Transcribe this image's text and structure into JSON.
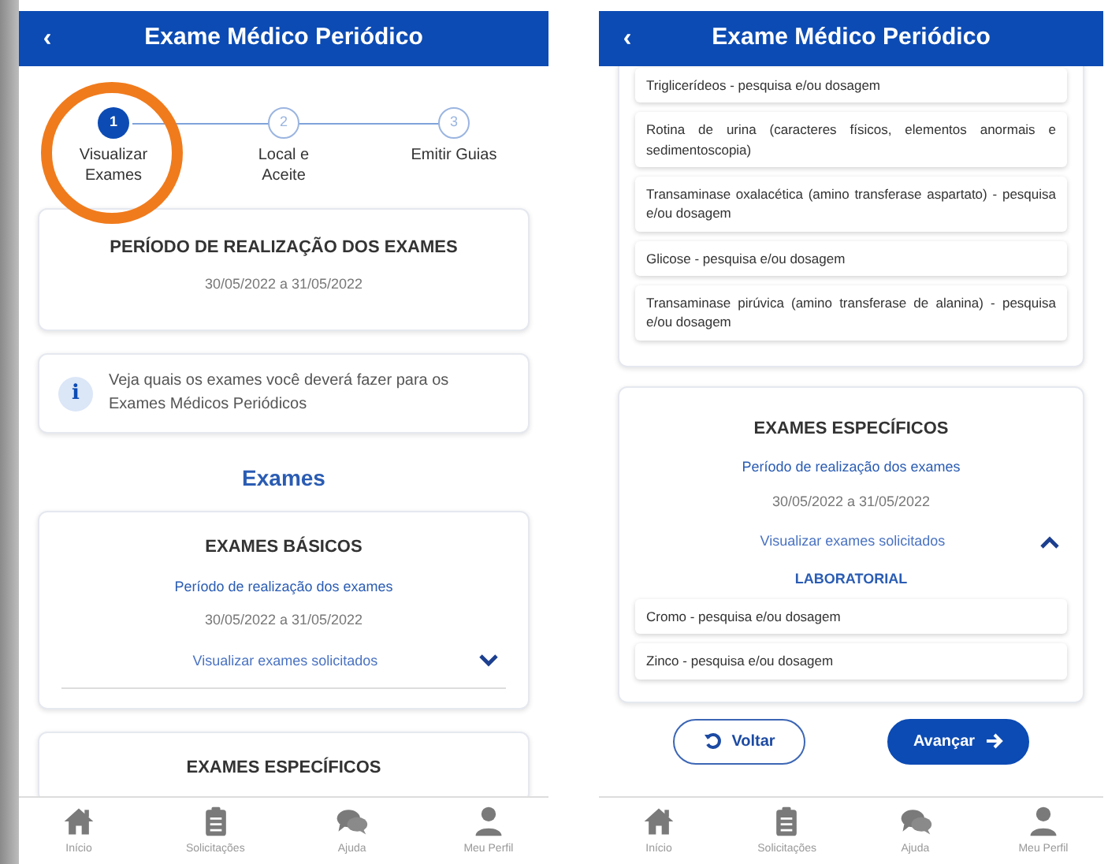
{
  "screens": [
    {
      "header": {
        "back": "‹",
        "title": "Exame Médico Periódico"
      },
      "blocks": [
        {
          "kind": "stepper",
          "steps": [
            {
              "number": "1",
              "label": "Visualizar Exames",
              "selected": true,
              "highlighted": true
            },
            {
              "number": "2",
              "label": "Local e Aceite",
              "selected": false,
              "highlighted": false
            },
            {
              "number": "3",
              "label": "Emitir Guias",
              "selected": false,
              "highlighted": false
            }
          ]
        },
        {
          "kind": "period_card",
          "title": "PERÍODO DE REALIZAÇÃO DOS EXAMES",
          "dates": "30/05/2022 a 31/05/2022"
        },
        {
          "kind": "info",
          "icon": "i",
          "text": "Veja quais os exames você deverá fazer para os Exames Médicos Periódicos"
        },
        {
          "kind": "section_title",
          "text": "Exames"
        },
        {
          "kind": "exam_card",
          "title": "EXAMES BÁSICOS",
          "period_label": "Período de realização dos exames",
          "dates": "30/05/2022 a 31/05/2022",
          "toggle": "Visualizar exames solicitados",
          "expanded": false
        },
        {
          "kind": "exam_card",
          "title": "EXAMES ESPECÍFICOS"
        }
      ],
      "bottom_nav": [
        {
          "label": "Início"
        },
        {
          "label": "Solicitações"
        },
        {
          "label": "Ajuda"
        },
        {
          "label": "Meu Perfil"
        }
      ]
    },
    {
      "header": {
        "back": "‹",
        "title": "Exame Médico Periódico"
      },
      "blocks": [
        {
          "kind": "exam_list",
          "items": [
            "Triglicerídeos - pesquisa e/ou dosagem",
            "Rotina de urina (caracteres físicos, elementos anormais e sedimentoscopia)",
            "Transaminase oxalacética (amino transferase aspartato) - pesquisa e/ou dosagem",
            "Glicose - pesquisa e/ou dosagem",
            "Transaminase pirúvica (amino transferase de alanina) - pesquisa e/ou dosagem"
          ]
        },
        {
          "kind": "exam_card",
          "title": "EXAMES ESPECÍFICOS",
          "period_label": "Período de realização dos exames",
          "dates": "30/05/2022 a 31/05/2022",
          "toggle": "Visualizar exames solicitados",
          "expanded": true,
          "category": "LABORATORIAL",
          "items": [
            "Cromo - pesquisa e/ou dosagem",
            "Zinco - pesquisa e/ou dosagem"
          ]
        },
        {
          "kind": "buttons",
          "buttons": [
            {
              "label": "Voltar",
              "kind": "secondary"
            },
            {
              "label": "Avançar",
              "kind": "primary"
            }
          ]
        }
      ],
      "bottom_nav": [
        {
          "label": "Início"
        },
        {
          "label": "Solicitações"
        },
        {
          "label": "Ajuda"
        },
        {
          "label": "Meu Perfil"
        }
      ]
    }
  ]
}
